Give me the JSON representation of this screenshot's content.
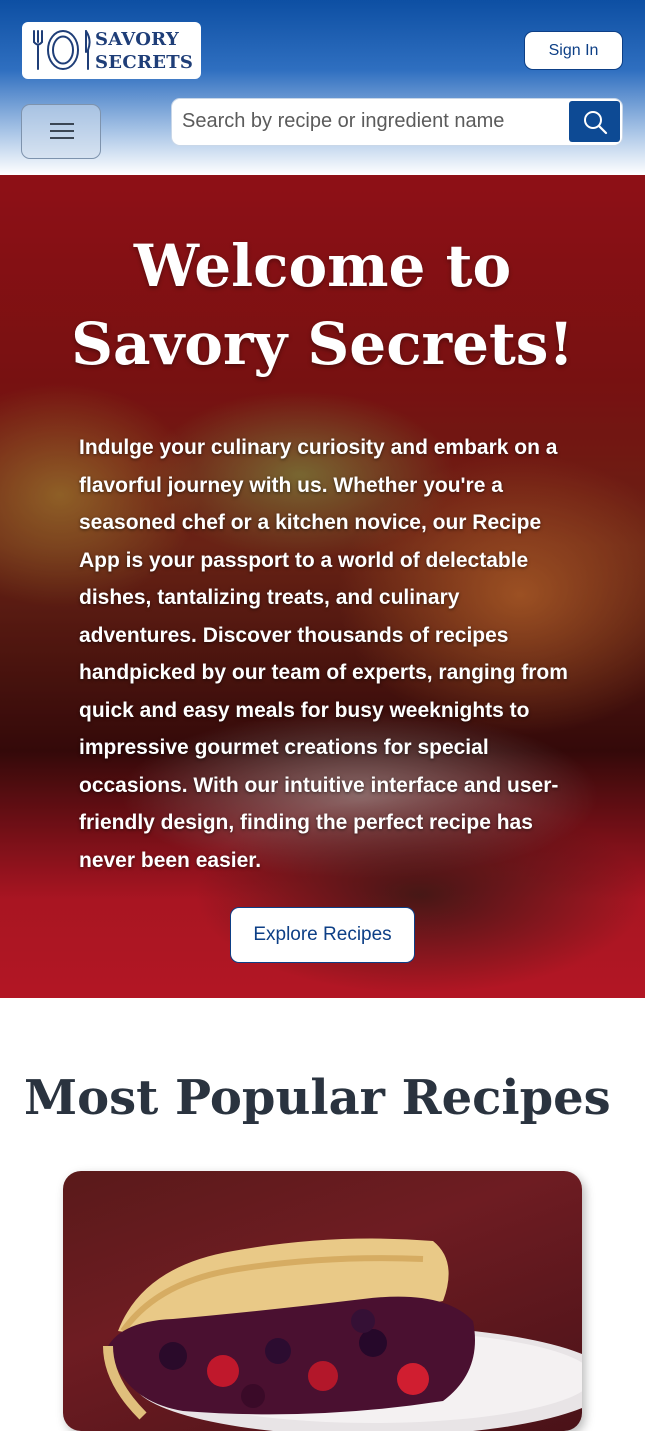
{
  "brand": {
    "line1": "SAVORY",
    "line2": "SECRETS",
    "icon": "plate-fork-knife-icon"
  },
  "header": {
    "sign_in_label": "Sign In",
    "menu_icon": "hamburger-menu-icon"
  },
  "search": {
    "placeholder": "Search by recipe or ingredient name",
    "value": "",
    "icon": "search-icon"
  },
  "hero": {
    "title": "Welcome to Savory Secrets!",
    "description": "Indulge your culinary curiosity and embark on a flavorful journey with us. Whether you're a seasoned chef or a kitchen novice, our Recipe App is your passport to a world of delectable dishes, tantalizing treats, and culinary adventures. Discover thousands of recipes handpicked by our team of experts, ranging from quick and easy meals for busy weeknights to impressive gourmet creations for special occasions. With our intuitive interface and user-friendly design, finding the perfect recipe has never been easier.",
    "cta_label": "Explore Recipes"
  },
  "popular": {
    "title": "Most Popular Recipes"
  },
  "colors": {
    "brand_blue": "#0d4a94",
    "accent_navy": "#0d3f86",
    "heading_dark": "#2a333f"
  }
}
